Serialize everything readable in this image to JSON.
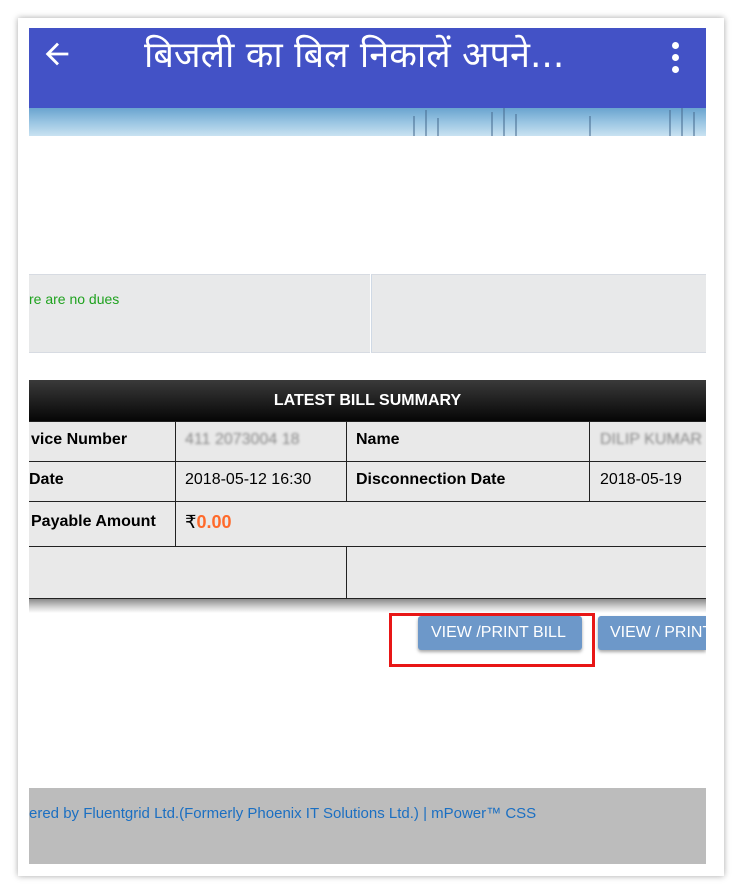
{
  "app_bar": {
    "back_icon": "arrow-left-icon",
    "title": "बिजली का बिल निकालें अपने...",
    "menu_icon": "more-vert-icon",
    "color": "#4352c6"
  },
  "notice": {
    "text": "re are no dues",
    "color": "#1fa21f"
  },
  "bill_summary": {
    "header": "LATEST BILL SUMMARY",
    "rows": [
      {
        "label": "vice Number",
        "value": "411 2073004 18",
        "label2": "Name",
        "value2": "DILIP KUMAR"
      },
      {
        "label": " Date",
        "value": "2018-05-12 16:30",
        "label2": "Disconnection Date",
        "value2": "2018-05-19"
      }
    ],
    "payable_label": "Payable Amount",
    "currency_symbol": "₹",
    "payable_amount": "0.00",
    "amount_color": "#ff6a2b"
  },
  "buttons": {
    "view_print_bill": "VIEW /PRINT BILL",
    "view_print_second": "VIEW / PRINT",
    "button_color": "#6d98c9"
  },
  "footer": {
    "text": "ered by Fluentgrid Ltd.(Formerly Phoenix IT Solutions Ltd.) | mPower™ CSS",
    "link_color": "#1b6fc2"
  }
}
